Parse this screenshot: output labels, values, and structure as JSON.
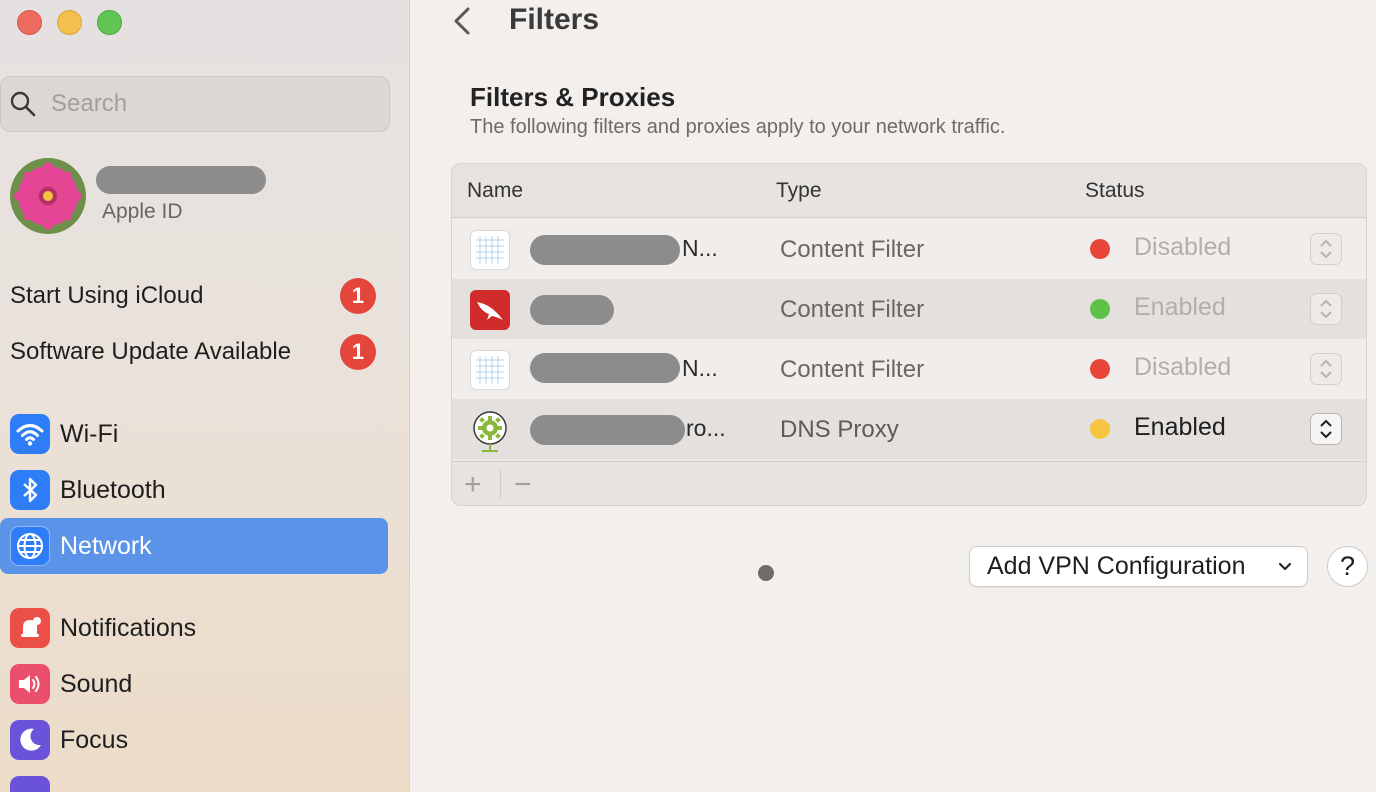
{
  "window": {
    "title": "Filters"
  },
  "sidebar": {
    "search": {
      "placeholder": "Search",
      "icon": "magnifier-icon"
    },
    "account": {
      "name": "",
      "subtitle": "Apple ID"
    },
    "notices": [
      {
        "label": "Start Using iCloud",
        "badge": "1"
      },
      {
        "label": "Software Update Available",
        "badge": "1"
      }
    ],
    "items": [
      {
        "label": "Wi-Fi",
        "icon": "wifi-icon",
        "color": "#2f7df6"
      },
      {
        "label": "Bluetooth",
        "icon": "bluetooth-icon",
        "color": "#2f7df6"
      },
      {
        "label": "Network",
        "icon": "globe-icon",
        "color": "#2f7df6",
        "selected": true
      },
      {
        "label": "Notifications",
        "icon": "bell-icon",
        "color": "#ec4f48"
      },
      {
        "label": "Sound",
        "icon": "speaker-icon",
        "color": "#ec4f6b"
      },
      {
        "label": "Focus",
        "icon": "moon-icon",
        "color": "#6a53d8"
      }
    ],
    "colors": {
      "selected": "#5a93e8",
      "badge": "#e5463c"
    }
  },
  "main": {
    "back_icon": "chevron-left-icon",
    "title": "Filters",
    "section": {
      "title": "Filters & Proxies",
      "subtitle": "The following filters and proxies apply to your network traffic."
    },
    "table": {
      "columns": [
        "Name",
        "Type",
        "Status"
      ],
      "rows": [
        {
          "name_visible": "N...",
          "type": "Content Filter",
          "status": "Disabled",
          "status_color": "#e8463b",
          "icon": "filter-grid-icon"
        },
        {
          "name_visible": "",
          "type": "Content Filter",
          "status": "Enabled",
          "status_color": "#5ec249",
          "icon": "falcon-icon"
        },
        {
          "name_visible": "N...",
          "type": "Content Filter",
          "status": "Disabled",
          "status_color": "#e8463b",
          "icon": "filter-grid-icon"
        },
        {
          "name_visible": "ro...",
          "type": "DNS Proxy",
          "status": "Enabled",
          "status_color": "#f5c542",
          "icon": "gear-pin-icon"
        }
      ],
      "footer": {
        "add": "+",
        "remove": "−"
      }
    },
    "vpn_button": {
      "label": "Add VPN Configuration",
      "icon": "chevron-down-icon"
    },
    "help": {
      "label": "?"
    }
  }
}
